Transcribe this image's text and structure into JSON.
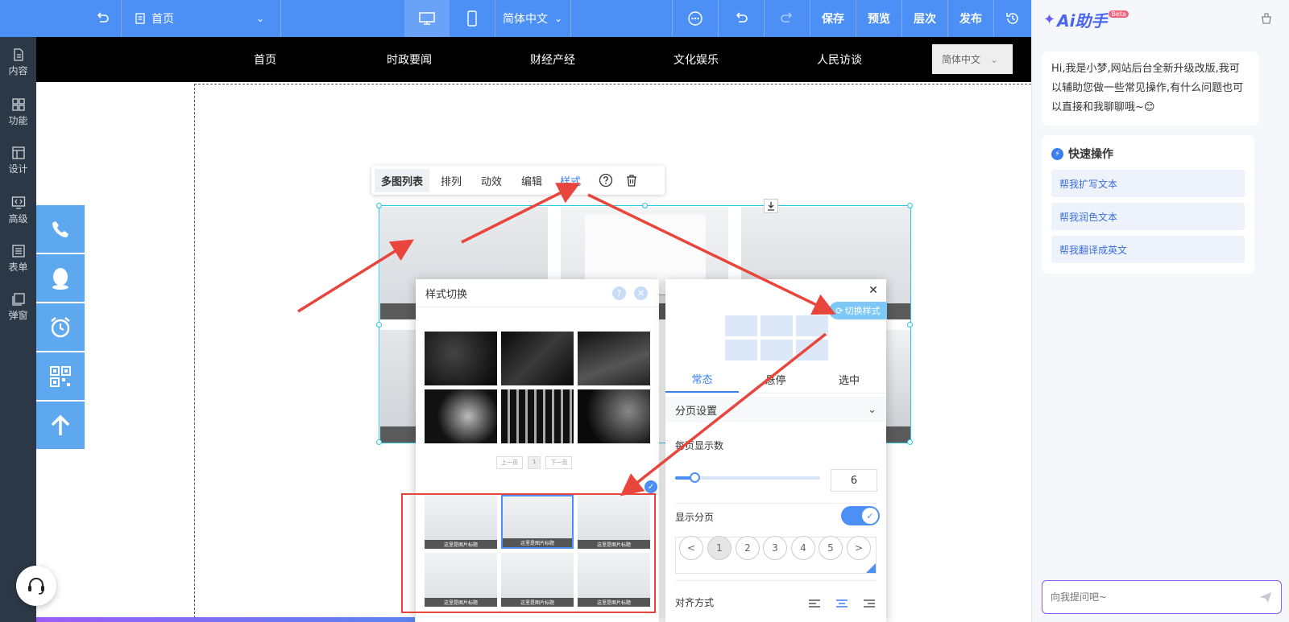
{
  "topbar": {
    "page_select": "首页",
    "language": "简体中文",
    "save": "保存",
    "preview": "预览",
    "layers": "层次",
    "publish": "发布"
  },
  "leftnav": {
    "items": [
      {
        "label": "内容",
        "icon": "document-icon"
      },
      {
        "label": "功能",
        "icon": "grid-icon"
      },
      {
        "label": "设计",
        "icon": "layout-icon"
      },
      {
        "label": "高级",
        "icon": "code-icon"
      },
      {
        "label": "表单",
        "icon": "form-icon"
      },
      {
        "label": "弹窗",
        "icon": "popup-icon"
      }
    ]
  },
  "sitenav": {
    "items": [
      "首页",
      "时政要闻",
      "财经产经",
      "文化娱乐",
      "人民访谈"
    ],
    "language": "简体中文"
  },
  "toolbar": {
    "items": [
      "多图列表",
      "排列",
      "动效",
      "编辑",
      "样式"
    ],
    "active": "样式"
  },
  "style_dialog": {
    "title": "样式切换",
    "prev": "上一页",
    "page": "1",
    "next": "下一页",
    "caption": "这里是图片标题"
  },
  "settings": {
    "switch_style": "切换样式",
    "tabs": [
      "常态",
      "悬停",
      "选中"
    ],
    "section": "分页设置",
    "per_page_label": "每页显示数",
    "per_page_value": "6",
    "show_pagination_label": "显示分页",
    "pager": [
      "<",
      "1",
      "2",
      "3",
      "4",
      "5",
      ">"
    ],
    "align_label": "对齐方式"
  },
  "ai": {
    "title": "Ai助手",
    "badge": "Beta",
    "greeting": "Hi,我是小梦,网站后台全新升级改版,我可以辅助您做一些常见操作,有什么问题也可以直接和我聊聊哦~😊",
    "quick_title": "快速操作",
    "quick": [
      "帮我扩写文本",
      "帮我润色文本",
      "帮我翻译成英文"
    ],
    "input_placeholder": "向我提问吧~"
  },
  "colors": {
    "accent": "#4c8ff5",
    "dark_nav": "#2c3846",
    "annotation": "#e8453c"
  }
}
